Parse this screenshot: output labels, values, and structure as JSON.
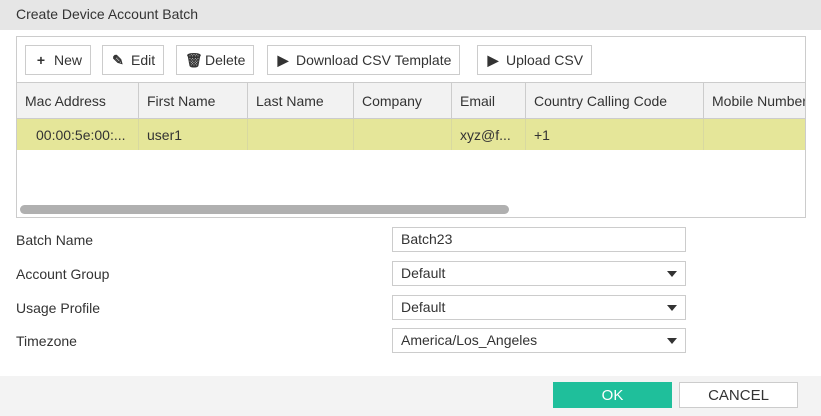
{
  "dialog": {
    "title": "Create Device Account Batch"
  },
  "toolbar": {
    "new": "New",
    "edit": "Edit",
    "delete": "Delete",
    "download": "Download CSV Template",
    "upload": "Upload CSV"
  },
  "table": {
    "columns": [
      "Mac Address",
      "First Name",
      "Last Name",
      "Company",
      "Email",
      "Country Calling Code",
      "Mobile Number"
    ],
    "rows": [
      [
        "00:00:5e:00:...",
        "user1",
        "",
        "",
        "xyz@f...",
        "+1",
        ""
      ]
    ]
  },
  "form": {
    "batch_name": {
      "label": "Batch Name",
      "value": "Batch23"
    },
    "account_group": {
      "label": "Account Group",
      "value": "Default"
    },
    "usage_profile": {
      "label": "Usage Profile",
      "value": "Default"
    },
    "timezone": {
      "label": "Timezone",
      "value": "America/Los_Angeles"
    }
  },
  "footer": {
    "ok": "OK",
    "cancel": "CANCEL"
  }
}
